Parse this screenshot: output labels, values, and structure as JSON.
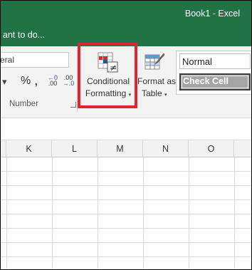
{
  "window": {
    "title": "Book1 - Excel"
  },
  "tell_me": {
    "text": "ant to do..."
  },
  "ribbon": {
    "number_format_value": "eral",
    "percent_label": "%",
    "comma_label": ",",
    "increase_decimal": {
      "top": "←0",
      "bottom": ".00"
    },
    "decrease_decimal": {
      "top": ".00",
      "bottom": "→.0"
    },
    "number_group_label": "Number",
    "conditional_formatting": {
      "line1": "Conditional",
      "line2": "Formatting"
    },
    "format_as_table": {
      "line1": "Format as",
      "line2": "Table"
    },
    "cell_styles": {
      "normal": "Normal",
      "check_cell": "Check Cell"
    }
  },
  "columns": [
    "K",
    "L",
    "M",
    "N",
    "O"
  ],
  "colors": {
    "excel_green": "#217346",
    "highlight_red": "#e0262c"
  }
}
